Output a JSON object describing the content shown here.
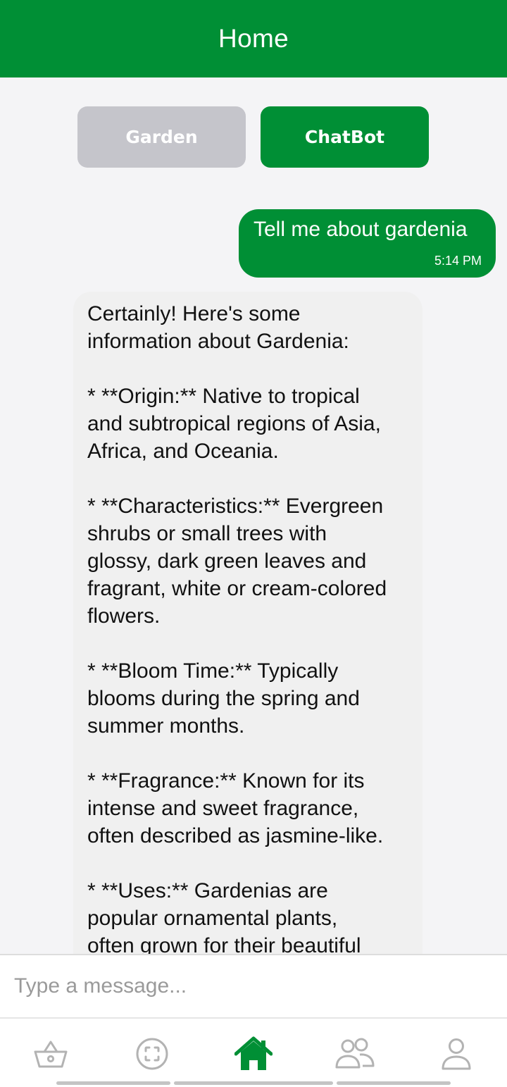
{
  "header": {
    "title": "Home"
  },
  "segments": {
    "garden_label": "Garden",
    "chatbot_label": "ChatBot"
  },
  "chat": {
    "user_message": {
      "text": "Tell me about gardenia",
      "time": "5:14 PM"
    },
    "bot_message": {
      "text": "Certainly! Here's some\ninformation about Gardenia:\n\n* **Origin:** Native to tropical\nand subtropical regions of Asia,\nAfrica, and Oceania.\n\n* **Characteristics:** Evergreen\nshrubs or small trees with\nglossy, dark green leaves and\nfragrant, white or cream-colored\nflowers.\n\n* **Bloom Time:** Typically\nblooms during the spring and\nsummer months.\n\n* **Fragrance:** Known for its\nintense and sweet fragrance,\noften described as jasmine-like.\n\n* **Uses:** Gardenias are\npopular ornamental plants,\noften grown for their beautiful"
    }
  },
  "composer": {
    "placeholder": "Type a message..."
  },
  "nav": {
    "items": [
      {
        "icon": "basket-icon",
        "active": false
      },
      {
        "icon": "scan-face-icon",
        "active": false
      },
      {
        "icon": "home-icon",
        "active": true
      },
      {
        "icon": "users-icon",
        "active": false
      },
      {
        "icon": "profile-icon",
        "active": false
      }
    ]
  },
  "colors": {
    "brand_green": "#008f35",
    "inactive_segment": "#c5c5cb",
    "icon_gray": "#b3b3b3",
    "bot_bubble": "#f0f0f0"
  }
}
